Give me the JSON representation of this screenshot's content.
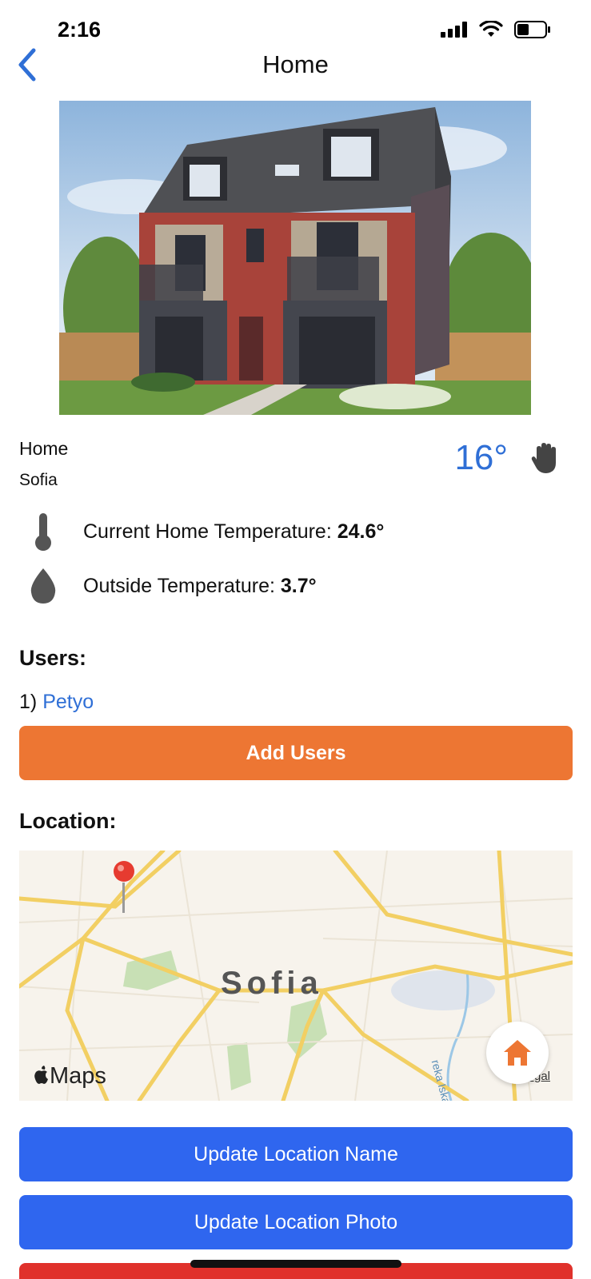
{
  "status_bar": {
    "time": "2:16"
  },
  "nav": {
    "title": "Home"
  },
  "home": {
    "name": "Home",
    "city": "Sofia",
    "weather_temp": "16°"
  },
  "stats": {
    "current_label": "Current Home Temperature: ",
    "current_value": "24.6°",
    "outside_label": "Outside Temperature: ",
    "outside_value": "3.7°"
  },
  "users": {
    "title": "Users:",
    "items": [
      {
        "index": "1)",
        "name": "Petyo"
      }
    ],
    "add_button": "Add Users"
  },
  "location": {
    "title": "Location:",
    "map_city_label": "Sofia",
    "maps_brand": "Maps",
    "legal": "Legal",
    "river_label": "reka Iskar"
  },
  "buttons": {
    "update_name": "Update Location Name",
    "update_photo": "Update Location Photo"
  },
  "colors": {
    "accent_blue": "#2f6fd6",
    "orange": "#ed7633",
    "button_blue": "#2f66ef",
    "red": "#e0312b"
  },
  "icons": {
    "back": "chevron-left-icon",
    "wave": "hand-wave-icon",
    "thermometer": "thermometer-icon",
    "drop": "drop-icon",
    "home": "home-icon",
    "pin": "map-pin-icon"
  }
}
